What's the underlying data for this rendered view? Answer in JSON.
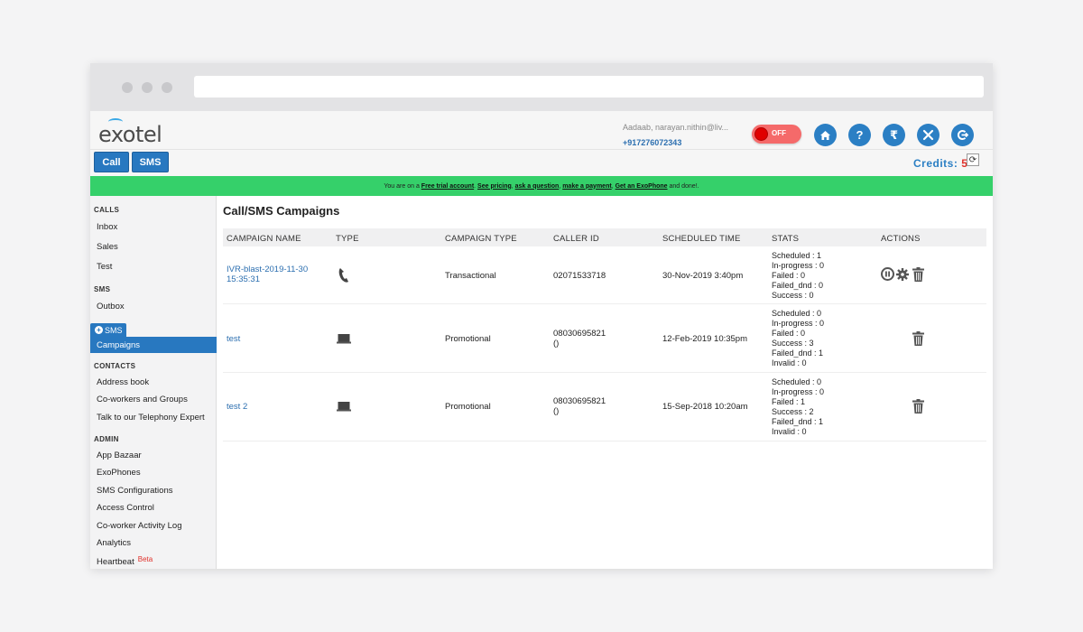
{
  "header": {
    "logo_text": "exotel",
    "user_greeting": "Aadaab, narayan.nithin@liv...",
    "user_phone": "+917276072343",
    "toggle_label": "OFF"
  },
  "toolbar": {
    "call_label": "Call",
    "sms_label": "SMS",
    "credits_label": "Credits:",
    "credits_value": "5"
  },
  "banner": {
    "prefix": "You are on a",
    "free_trial": "Free trial account",
    "see_pricing": "See pricing",
    "ask_question": "ask a question",
    "make_payment": "make a payment",
    "get_exophone": "Get an ExoPhone",
    "suffix": "and done!."
  },
  "sidebar": {
    "calls_header": "CALLS",
    "calls_items": [
      "Inbox",
      "Sales",
      "Test"
    ],
    "sms_header": "SMS",
    "sms_items": [
      "Outbox"
    ],
    "sms_tag": "SMS",
    "active_item": "Campaigns",
    "contacts_header": "CONTACTS",
    "contacts_items": [
      "Address book",
      "Co-workers and Groups",
      "Talk to our Telephony Expert"
    ],
    "admin_header": "ADMIN",
    "admin_items": [
      "App Bazaar",
      "ExoPhones",
      "SMS Configurations",
      "Access Control",
      "Co-worker Activity Log",
      "Analytics",
      "Heartbeat"
    ],
    "beta_label": "Beta"
  },
  "main": {
    "title": "Call/SMS Campaigns",
    "columns": [
      "CAMPAIGN NAME",
      "TYPE",
      "CAMPAIGN TYPE",
      "CALLER ID",
      "SCHEDULED TIME",
      "STATS",
      "ACTIONS"
    ],
    "rows": [
      {
        "name_line1": "IVR-blast-2019-11-30",
        "name_line2": "15:35:31",
        "type_icon": "phone-icon",
        "campaign_type": "Transactional",
        "caller_id_line1": "02071533718",
        "caller_id_line2": "",
        "scheduled_time": "30-Nov-2019 3:40pm",
        "stats": [
          "Scheduled : 1",
          "In-progress : 0",
          "Failed : 0",
          "Failed_dnd : 0",
          "Success : 0"
        ]
      },
      {
        "name_line1": "test",
        "name_line2": "",
        "type_icon": "laptop-icon",
        "campaign_type": "Promotional",
        "caller_id_line1": "08030695821",
        "caller_id_line2": "()",
        "scheduled_time": "12-Feb-2019 10:35pm",
        "stats": [
          "Scheduled : 0",
          "In-progress : 0",
          "Failed : 0",
          "Success : 3",
          "Failed_dnd : 1",
          "Invalid : 0"
        ]
      },
      {
        "name_line1": "test 2",
        "name_line2": "",
        "type_icon": "laptop-icon",
        "campaign_type": "Promotional",
        "caller_id_line1": "08030695821",
        "caller_id_line2": "()",
        "scheduled_time": "15-Sep-2018 10:20am",
        "stats": [
          "Scheduled : 0",
          "In-progress : 0",
          "Failed : 1",
          "Success : 2",
          "Failed_dnd : 1",
          "Invalid : 0"
        ]
      }
    ]
  },
  "colors": {
    "primary": "#2878c0",
    "banner_green": "#35d06a",
    "credits_red": "#e0302a"
  }
}
